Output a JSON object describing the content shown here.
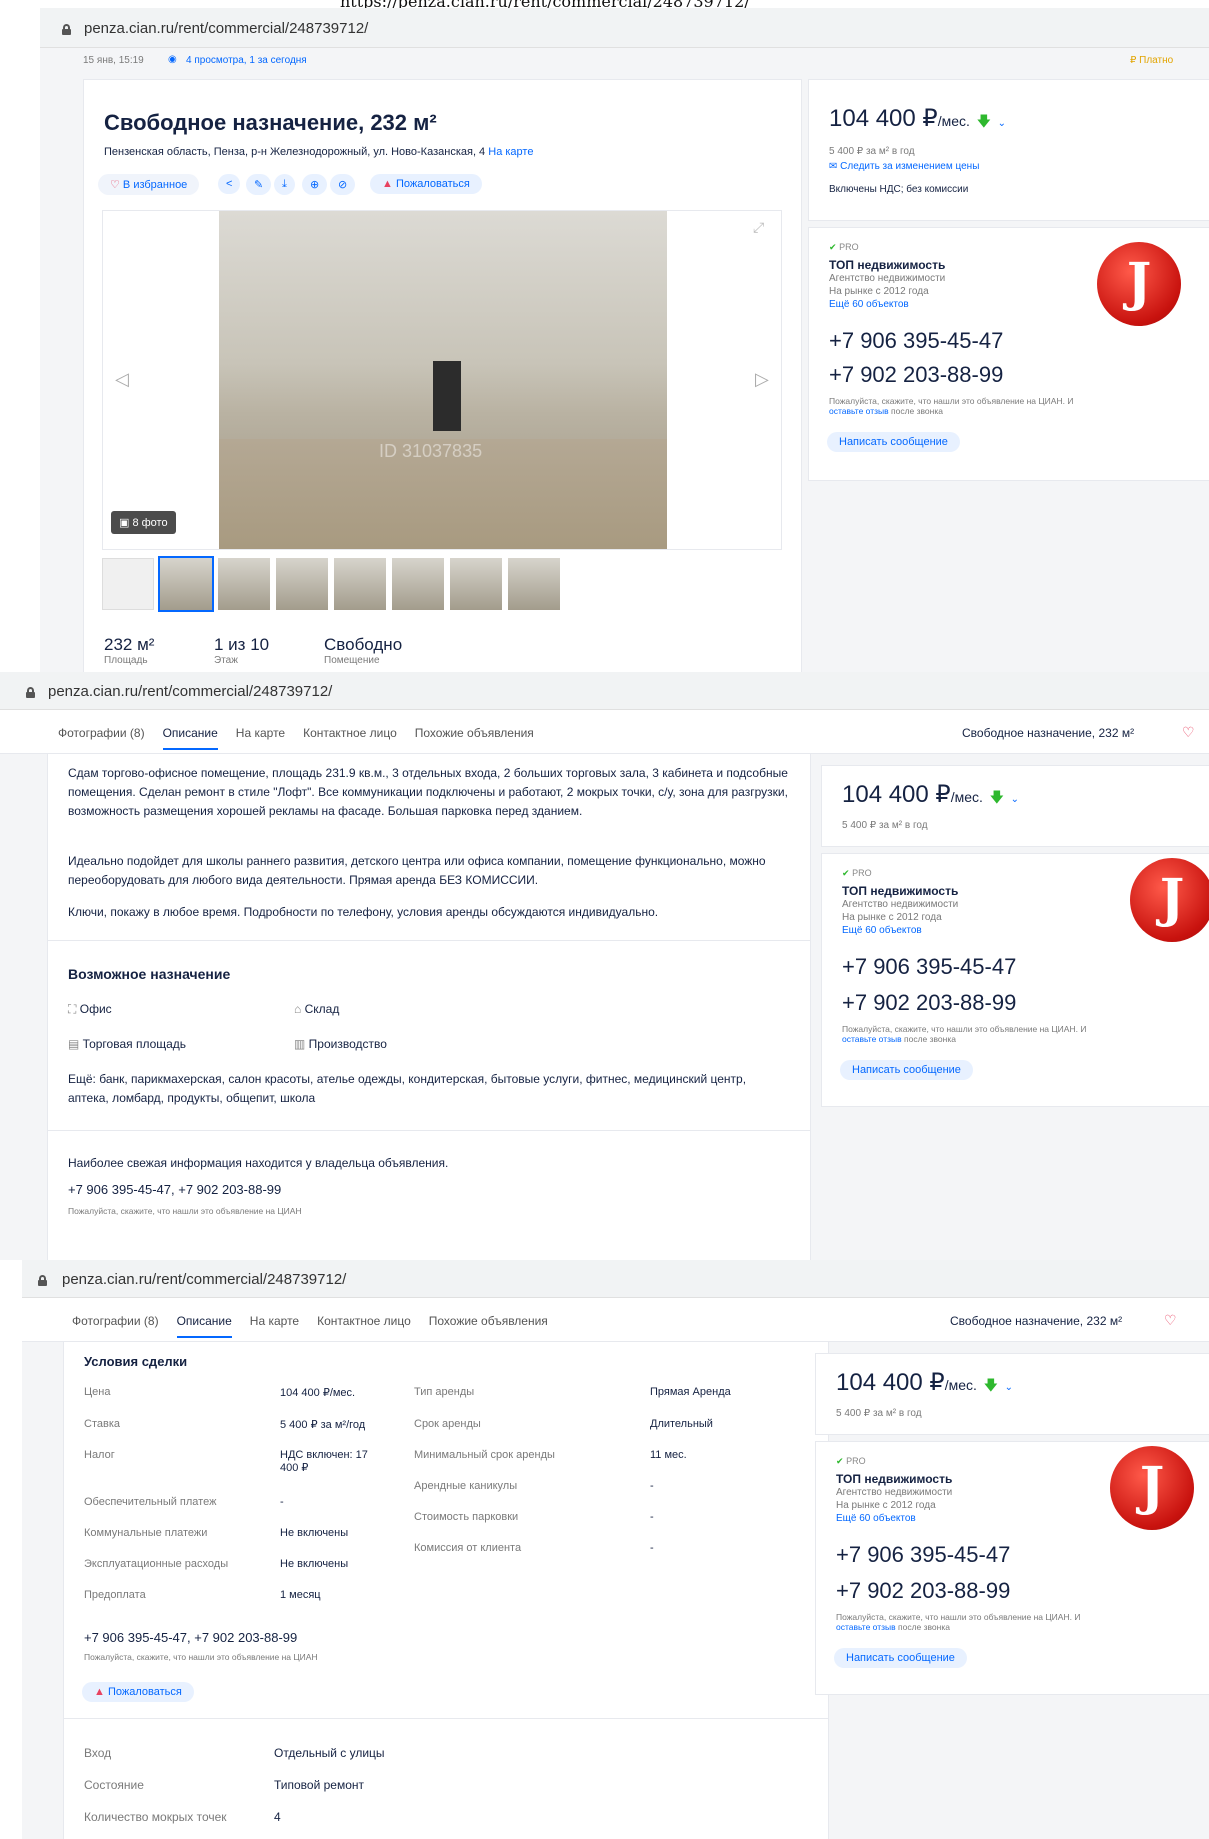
{
  "top_url": "https://penza.cian.ru/rent/commercial/248739712/",
  "s1": {
    "url": "penza.cian.ru/rent/commercial/248739712/",
    "meta_date": "15 янв, 15:19",
    "meta_views": "4 просмотра, 1 за сегодня",
    "paid": "Платно",
    "title": "Свободное назначение, 232 м²",
    "address": "Пензенская область, Пенза, р-н Железнодорожный, ул. Ново-Казанская, 4",
    "map_link": "На карте",
    "favorite": "В избранное",
    "report": "Пожаловаться",
    "photo_count": "8 фото",
    "watermark": "ID 31037835",
    "stats": [
      {
        "value": "232 м²",
        "label": "Площадь"
      },
      {
        "value": "1 из 10",
        "label": "Этаж"
      },
      {
        "value": "Свободно",
        "label": "Помещение"
      }
    ],
    "price": "104 400 ₽",
    "price_unit": "/мес.",
    "per_m2": "5 400 ₽ за м² в год",
    "follow": "Следить за изменением цены",
    "vat": "Включены НДС; без комиссии"
  },
  "agent": {
    "pro": "PRO",
    "name": "ТОП недвижимость",
    "type": "Агентство недвижимости",
    "since": "На рынке с 2012 года",
    "more": "Ещё 60 объектов",
    "phone1": "+7 906 395-45-47",
    "phone2": "+7 902 203-88-99",
    "note_a": "Пожалуйста, скажите, что нашли это объявление на ЦИАН. И ",
    "note_link": "оставьте отзыв",
    "note_b": " после звонка",
    "message": "Написать сообщение",
    "logo_letter": "J"
  },
  "tabs": [
    "Фотографии (8)",
    "Описание",
    "На карте",
    "Контактное лицо",
    "Похожие объявления"
  ],
  "s2": {
    "url": "penza.cian.ru/rent/commercial/248739712/",
    "header_title": "Свободное назначение, 232 м²",
    "desc1": "Сдам торгово-офисное помещение, площадь 231.9 кв.м., 3 отдельных входа, 2 больших торговых зала, 3 кабинета и подсобные помещения. Сделан ремонт в стиле \"Лофт\". Все коммуникации подключены и работают, 2 мокрых точки, с/у, зона для разгрузки, возможность размещения хорошей рекламы на фасаде. Большая парковка перед зданием.",
    "desc2": "Идеально подойдет для школы раннего развития, детского центра или офиса компании, помещение функционально, можно переоборудовать для любого вида деятельности. Прямая аренда БЕЗ КОМИССИИ.",
    "desc3": "Ключи, покажу в любое время. Подробности по телефону, условия аренды обсуждаются индивидуально.",
    "purpose_title": "Возможное назначение",
    "purposes": [
      "Офис",
      "Склад",
      "Торговая площадь",
      "Производство"
    ],
    "more_purposes": "Ещё: банк, парикмахерская, салон красоты, ателье одежды, кондитерская, бытовые услуги, фитнес, медицинский центр, аптека, ломбард, продукты, общепит, школа",
    "fresh_info": "Наиболее свежая информация находится у владельца объявления.",
    "phones": "+7 906 395-45-47, +7 902 203-88-99",
    "phones_note": "Пожалуйста, скажите, что нашли это объявление на ЦИАН"
  },
  "s3": {
    "url": "penza.cian.ru/rent/commercial/248739712/",
    "header_title": "Свободное назначение, 232 м²",
    "deal_title": "Условия сделки",
    "left_rows": [
      {
        "k": "Цена",
        "v": "104 400 ₽/мес."
      },
      {
        "k": "Ставка",
        "v": "5 400 ₽ за м²/год"
      },
      {
        "k": "Налог",
        "v": "НДС включен: 17 400 ₽"
      },
      {
        "k": "Обеспечительный платеж",
        "v": "-"
      },
      {
        "k": "Коммунальные платежи",
        "v": "Не включены"
      },
      {
        "k": "Эксплуатационные расходы",
        "v": "Не включены"
      },
      {
        "k": "Предоплата",
        "v": "1 месяц"
      }
    ],
    "right_rows": [
      {
        "k": "Тип аренды",
        "v": "Прямая Аренда"
      },
      {
        "k": "Срок аренды",
        "v": "Длительный"
      },
      {
        "k": "Минимальный срок аренды",
        "v": "11 мес."
      },
      {
        "k": "Арендные каникулы",
        "v": "-"
      },
      {
        "k": "Стоимость парковки",
        "v": "-"
      },
      {
        "k": "Комиссия от клиента",
        "v": "-"
      }
    ],
    "phones": "+7 906 395-45-47, +7 902 203-88-99",
    "phones_note": "Пожалуйста, скажите, что нашли это объявление на ЦИАН",
    "report": "Пожаловаться",
    "extra_rows": [
      {
        "k": "Вход",
        "v": "Отдельный с улицы"
      },
      {
        "k": "Состояние",
        "v": "Типовой ремонт"
      },
      {
        "k": "Количество мокрых точек",
        "v": "4"
      }
    ]
  }
}
